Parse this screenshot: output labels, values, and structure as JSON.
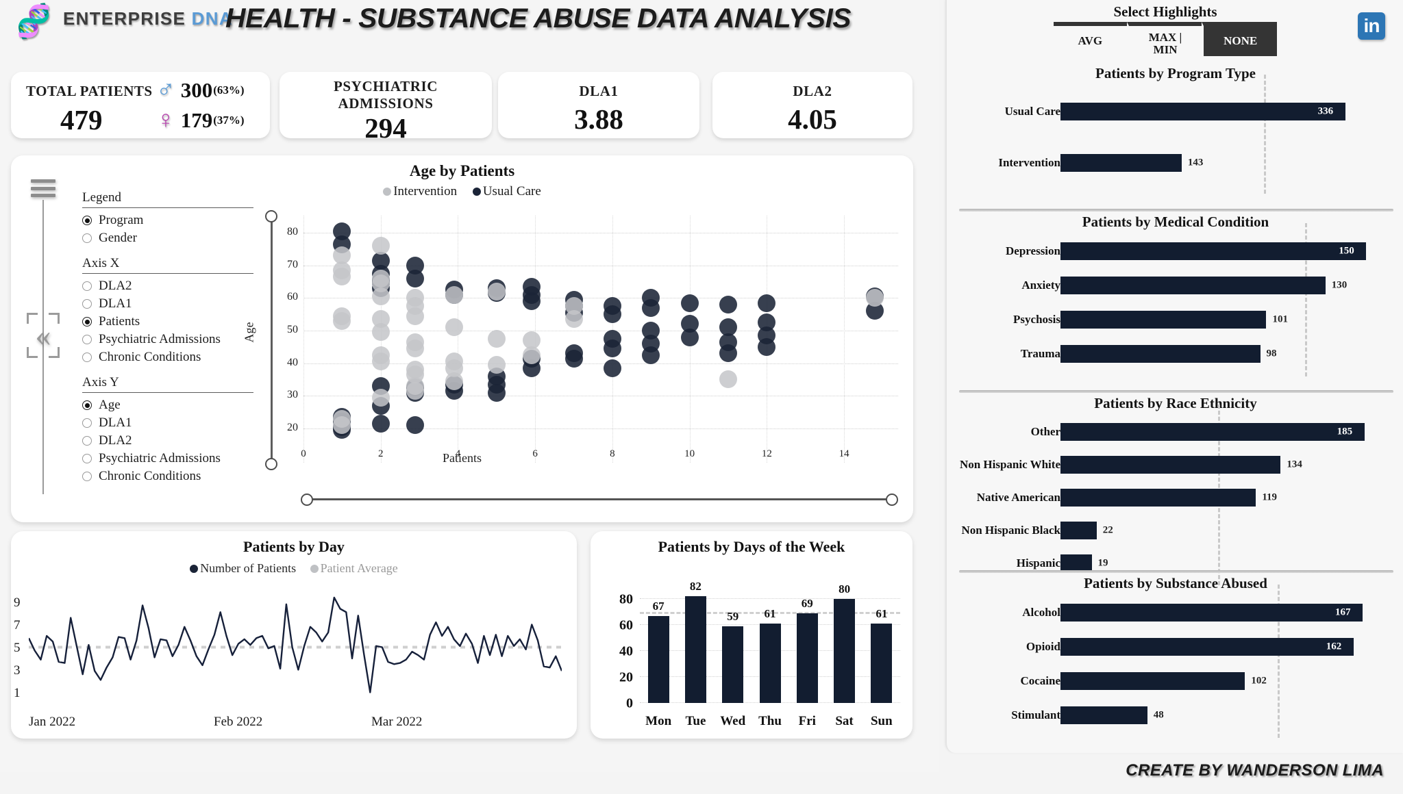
{
  "header": {
    "brand_prefix": "ENTERPRISE ",
    "brand_dna": "DNA",
    "title": "HEALTH - SUBSTANCE ABUSE DATA ANALYSIS",
    "logo_icon": "dna-helix-icon"
  },
  "kpis": {
    "total": {
      "label": "TOTAL PATIENTS",
      "value": "479",
      "male": {
        "icon": "male-gender-icon",
        "value": "300",
        "pct": "(63%)"
      },
      "female": {
        "icon": "female-gender-icon",
        "value": "179",
        "pct": "(37%)"
      }
    },
    "psychiatric": {
      "label_line1": "PSYCHIATRIC",
      "label_line2": "ADMISSIONS",
      "value": "294"
    },
    "dla1": {
      "label": "DLA1",
      "value": "3.88"
    },
    "dla2": {
      "label": "DLA2",
      "value": "4.05"
    }
  },
  "filters": {
    "groups": [
      {
        "title": "Legend",
        "options": [
          {
            "label": "Program",
            "selected": true
          },
          {
            "label": "Gender",
            "selected": false
          }
        ]
      },
      {
        "title": "Axis X",
        "options": [
          {
            "label": "DLA2",
            "selected": false
          },
          {
            "label": "DLA1",
            "selected": false
          },
          {
            "label": "Patients",
            "selected": true
          },
          {
            "label": "Psychiatric Admissions",
            "selected": false
          },
          {
            "label": "Chronic Conditions",
            "selected": false
          }
        ]
      },
      {
        "title": "Axis Y",
        "options": [
          {
            "label": "Age",
            "selected": true
          },
          {
            "label": "DLA1",
            "selected": false
          },
          {
            "label": "DLA2",
            "selected": false
          },
          {
            "label": "Psychiatric Admissions",
            "selected": false
          },
          {
            "label": "Chronic Conditions",
            "selected": false
          }
        ]
      }
    ],
    "hamburger_icon": "hamburger-menu-icon",
    "collapse_icon": "double-chevron-left-icon"
  },
  "select_highlights": {
    "title": "Select Highlights",
    "buttons": [
      {
        "label": "AVG",
        "active": false
      },
      {
        "label": "MAX | MIN",
        "active": false
      },
      {
        "label": "NONE",
        "active": true
      }
    ],
    "linkedin_icon": "linkedin-icon",
    "linkedin_glyph": "in"
  },
  "footer": {
    "credit": "CREATE BY WANDERSON LIMA"
  },
  "chart_data": [
    {
      "id": "age-by-patients",
      "type": "scatter",
      "title": "Age by Patients",
      "xlabel": "Patients",
      "ylabel": "Age",
      "xlim": [
        0,
        15.4
      ],
      "ylim": [
        16,
        84
      ],
      "xticks": [
        0,
        2,
        4,
        6,
        8,
        10,
        12,
        14
      ],
      "yticks": [
        20,
        30,
        40,
        50,
        60,
        70,
        80
      ],
      "grid": true,
      "legend_position": "top-center",
      "legend": [
        {
          "name": "Intervention",
          "color": "#c4c6c9"
        },
        {
          "name": "Usual Care",
          "color": "#1b2437"
        }
      ],
      "series": [
        {
          "name": "Usual Care",
          "color": "#1b2437",
          "points": [
            [
              1.0,
              80.5
            ],
            [
              1.0,
              76.5
            ],
            [
              1.0,
              23.5
            ],
            [
              1.0,
              22.0
            ],
            [
              1.0,
              20.5
            ],
            [
              1.0,
              19.5
            ],
            [
              2.0,
              71.5
            ],
            [
              2.0,
              67.5
            ],
            [
              2.0,
              65.5
            ],
            [
              2.0,
              64.5
            ],
            [
              2.0,
              63.0
            ],
            [
              2.0,
              33.0
            ],
            [
              2.0,
              27.0
            ],
            [
              2.0,
              21.5
            ],
            [
              2.9,
              70.0
            ],
            [
              2.9,
              66.0
            ],
            [
              2.9,
              32.5
            ],
            [
              2.9,
              31.0
            ],
            [
              2.9,
              21.0
            ],
            [
              3.9,
              62.5
            ],
            [
              3.9,
              61.0
            ],
            [
              3.9,
              33.5
            ],
            [
              3.9,
              31.5
            ],
            [
              5.0,
              63.0
            ],
            [
              5.0,
              61.5
            ],
            [
              5.0,
              36.0
            ],
            [
              5.0,
              33.5
            ],
            [
              5.0,
              31.0
            ],
            [
              5.9,
              63.5
            ],
            [
              5.9,
              61.0
            ],
            [
              5.9,
              59.0
            ],
            [
              5.9,
              41.5
            ],
            [
              5.9,
              38.5
            ],
            [
              7.0,
              59.5
            ],
            [
              7.0,
              57.5
            ],
            [
              7.0,
              55.5
            ],
            [
              7.0,
              43.0
            ],
            [
              7.0,
              41.5
            ],
            [
              8.0,
              57.5
            ],
            [
              8.0,
              55.0
            ],
            [
              8.0,
              47.5
            ],
            [
              8.0,
              44.5
            ],
            [
              8.0,
              38.5
            ],
            [
              9.0,
              60.0
            ],
            [
              9.0,
              57.0
            ],
            [
              9.0,
              50.0
            ],
            [
              9.0,
              46.0
            ],
            [
              9.0,
              42.5
            ],
            [
              10.0,
              58.5
            ],
            [
              10.0,
              52.0
            ],
            [
              10.0,
              48.0
            ],
            [
              11.0,
              58.0
            ],
            [
              11.0,
              51.0
            ],
            [
              11.0,
              46.5
            ],
            [
              11.0,
              43.0
            ],
            [
              12.0,
              58.5
            ],
            [
              12.0,
              52.5
            ],
            [
              12.0,
              48.5
            ],
            [
              12.0,
              45.0
            ],
            [
              14.8,
              60.5
            ],
            [
              14.8,
              56.0
            ]
          ]
        },
        {
          "name": "Intervention",
          "color": "#c4c6c9",
          "points": [
            [
              1.0,
              73.0
            ],
            [
              1.0,
              68.5
            ],
            [
              1.0,
              66.5
            ],
            [
              1.0,
              54.5
            ],
            [
              1.0,
              53.0
            ],
            [
              1.0,
              23.0
            ],
            [
              1.0,
              21.0
            ],
            [
              2.0,
              76.0
            ],
            [
              2.0,
              66.0
            ],
            [
              2.0,
              64.5
            ],
            [
              2.0,
              60.5
            ],
            [
              2.0,
              53.5
            ],
            [
              2.0,
              49.5
            ],
            [
              2.0,
              42.5
            ],
            [
              2.0,
              40.5
            ],
            [
              2.0,
              29.5
            ],
            [
              2.9,
              60.0
            ],
            [
              2.9,
              57.5
            ],
            [
              2.9,
              54.5
            ],
            [
              2.9,
              46.5
            ],
            [
              2.9,
              44.5
            ],
            [
              2.9,
              38.0
            ],
            [
              2.9,
              36.5
            ],
            [
              2.9,
              33.0
            ],
            [
              2.9,
              31.5
            ],
            [
              3.9,
              61.0
            ],
            [
              3.9,
              51.0
            ],
            [
              3.9,
              40.5
            ],
            [
              3.9,
              38.5
            ],
            [
              3.9,
              34.5
            ],
            [
              5.0,
              62.0
            ],
            [
              5.0,
              47.5
            ],
            [
              5.0,
              39.5
            ],
            [
              5.9,
              47.0
            ],
            [
              5.9,
              42.5
            ],
            [
              7.0,
              57.5
            ],
            [
              7.0,
              53.5
            ],
            [
              11.0,
              35.0
            ],
            [
              14.8,
              60.0
            ]
          ]
        }
      ],
      "x_slider": {
        "min_label": "",
        "max_label": ""
      }
    },
    {
      "id": "patients-by-day",
      "type": "line",
      "title": "Patients by Day",
      "xlabel": "",
      "ylabel": "",
      "yticks": [
        1,
        3,
        5,
        7,
        9
      ],
      "ylim": [
        0,
        10.6
      ],
      "grid": false,
      "legend_position": "top-center",
      "legend": [
        {
          "name": "Number of Patients",
          "color": "#16203a"
        },
        {
          "name": "Patient Average",
          "color": "#c9c9c9"
        }
      ],
      "xtick_labels": [
        "Jan 2022",
        "Feb 2022",
        "Mar 2022"
      ],
      "average": 5.3,
      "series": [
        {
          "name": "Number of Patients",
          "color": "#16203a",
          "values": [
            6.1,
            5.0,
            4.2,
            6.3,
            5.8,
            4.0,
            3.9,
            7.9,
            5.4,
            2.9,
            5.5,
            3.2,
            2.4,
            3.5,
            4.4,
            6.2,
            6.1,
            4.2,
            5.9,
            9.0,
            7.0,
            4.4,
            6.0,
            5.9,
            4.5,
            5.5,
            7.1,
            5.9,
            4.5,
            3.7,
            5.1,
            6.4,
            8.4,
            6.3,
            4.6,
            5.6,
            6.0,
            5.5,
            6.1,
            6.3,
            5.2,
            5.4,
            3.4,
            9.1,
            5.3,
            3.3,
            5.4,
            7.1,
            6.6,
            5.8,
            6.6,
            9.7,
            8.7,
            8.4,
            4.3,
            8.1,
            4.6,
            1.3,
            5.4,
            5.3,
            4.0,
            3.8,
            3.9,
            4.2,
            4.9,
            4.6,
            4.2,
            6.4,
            7.5,
            6.3,
            7.1,
            6.0,
            5.4,
            6.5,
            5.6,
            3.9,
            6.3,
            4.6,
            6.4,
            4.5,
            6.3,
            5.4,
            6.0,
            5.1,
            7.3,
            5.9,
            3.6,
            3.5,
            4.5,
            3.2
          ]
        },
        {
          "name": "Patient Average",
          "color": "#c9c9c9",
          "constant": 5.3
        }
      ]
    },
    {
      "id": "patients-by-days-of-week",
      "type": "bar",
      "title": "Patients by Days of the Week",
      "categories": [
        "Mon",
        "Tue",
        "Wed",
        "Thu",
        "Fri",
        "Sat",
        "Sun"
      ],
      "values": [
        67,
        82,
        59,
        61,
        69,
        80,
        61
      ],
      "yticks": [
        0,
        20,
        40,
        60,
        80
      ],
      "ylim": [
        0,
        92
      ],
      "xlabel": "",
      "ylabel": "",
      "grid": true,
      "average": 68.4,
      "bar_color": "#121d30"
    },
    {
      "id": "patients-by-program-type",
      "type": "bar",
      "orientation": "horizontal",
      "title": "Patients by Program Type",
      "categories": [
        "Usual Care",
        "Intervention"
      ],
      "values": [
        336,
        143
      ],
      "max": 380,
      "average": 240,
      "bar_color": "#121d30"
    },
    {
      "id": "patients-by-medical-condition",
      "type": "bar",
      "orientation": "horizontal",
      "title": "Patients by Medical Condition",
      "categories": [
        "Depression",
        "Anxiety",
        "Psychosis",
        "Trauma"
      ],
      "values": [
        150,
        130,
        101,
        98
      ],
      "max": 158,
      "average": 120,
      "bar_color": "#121d30"
    },
    {
      "id": "patients-by-race-ethnicity",
      "type": "bar",
      "orientation": "horizontal",
      "title": "Patients by Race Ethnicity",
      "categories": [
        "Other",
        "Non Hispanic White",
        "Native American",
        "Non Hispanic Black",
        "Hispanic"
      ],
      "values": [
        185,
        134,
        119,
        22,
        19
      ],
      "max": 196,
      "average": 96,
      "bar_color": "#121d30"
    },
    {
      "id": "patients-by-substance-abused",
      "type": "bar",
      "orientation": "horizontal",
      "title": "Patients by Substance Abused",
      "categories": [
        "Alcohol",
        "Opioid",
        "Cocaine",
        "Stimulant"
      ],
      "values": [
        167,
        162,
        102,
        48
      ],
      "max": 178,
      "average": 120,
      "bar_color": "#121d30"
    }
  ]
}
